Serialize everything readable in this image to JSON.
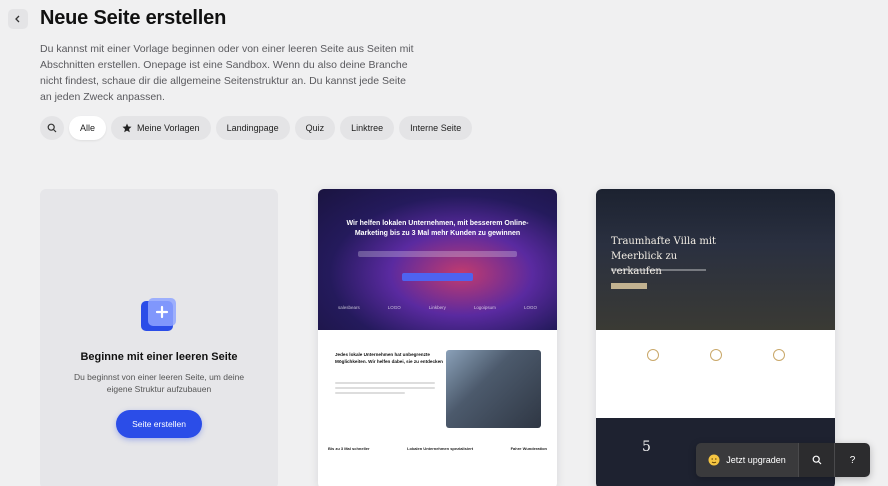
{
  "header": {
    "back_icon": "chevron-left-icon",
    "title": "Neue Seite erstellen",
    "intro": "Du kannst mit einer Vorlage beginnen oder von einer leeren Seite aus Seiten mit Abschnitten erstellen. Onepage ist eine Sandbox. Wenn du also deine Branche nicht findest, schaue dir die allgemeine Seitenstruktur an. Du kannst jede Seite an jeden Zweck anpassen."
  },
  "filters": {
    "search_icon": "search-icon",
    "items": [
      {
        "label": "Alle",
        "active": true
      },
      {
        "label": "Meine Vorlagen",
        "icon": "star-icon"
      },
      {
        "label": "Landingpage"
      },
      {
        "label": "Quiz"
      },
      {
        "label": "Linktree"
      },
      {
        "label": "Interne Seite"
      }
    ]
  },
  "blank_card": {
    "title": "Beginne mit einer leeren Seite",
    "description": "Du beginnst von einer leeren Seite, um deine eigene Struktur aufzubauen",
    "button": "Seite erstellen",
    "accent": "#2b4de8"
  },
  "template1": {
    "hero_title": "Wir helfen lokalen Unternehmen, mit besserem Online-Marketing bis zu 3 Mal mehr Kunden zu gewinnen",
    "logos": [
      "salesbears",
      "LOGO",
      "Linkbery",
      "Logoipsum",
      "LOGO"
    ],
    "section_title": "Jedes lokale Unternehmen hat unbegrenzte Möglichkeiten. Wir helfen dabei, sie zu entdecken",
    "features": [
      "Bis zu 3 Mal schneller",
      "Lokalen Unternehmen spezialisiert",
      "Fahre Wunderation"
    ]
  },
  "template2": {
    "hero_title": "Traumhafte Villa mit Meerblick zu verkaufen",
    "stat": "5"
  },
  "bottom_bar": {
    "upgrade_label": "Jetzt upgraden",
    "upgrade_icon": "emoji-icon",
    "search_icon": "search-icon",
    "help_label": "?"
  }
}
